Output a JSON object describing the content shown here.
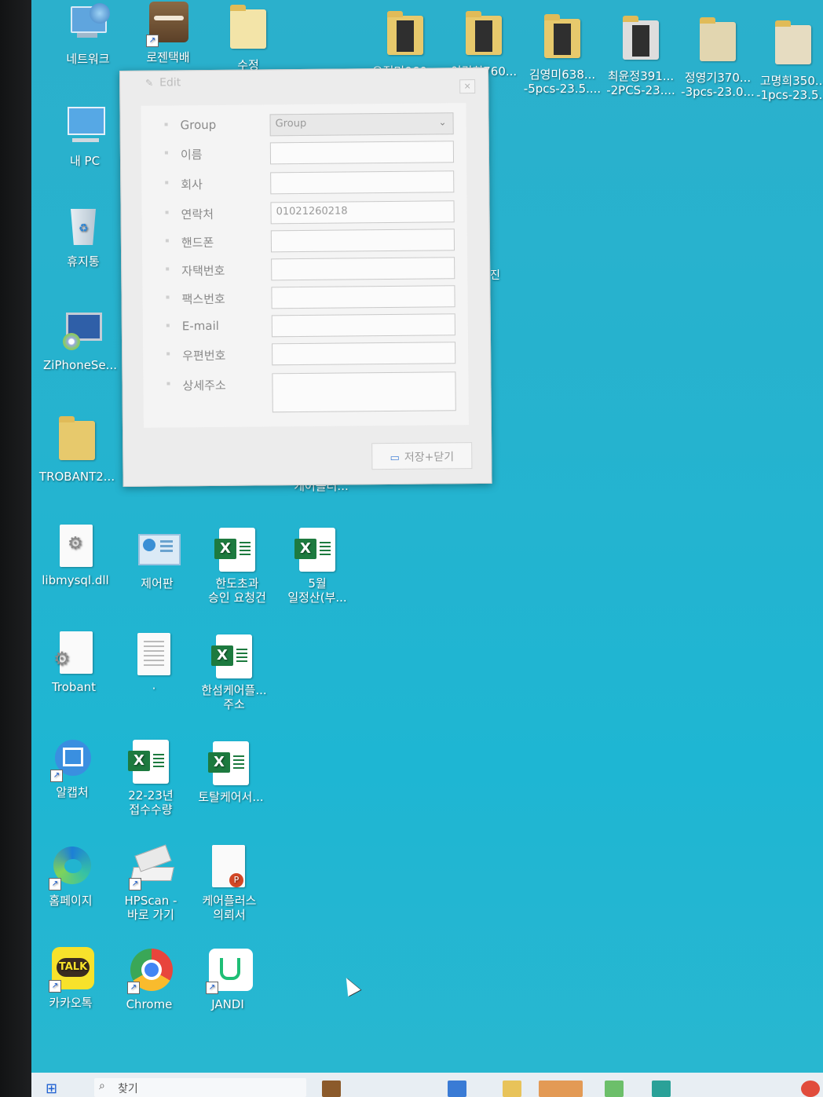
{
  "desktop_icons": [
    {
      "label": "네트워크",
      "icon": "network-icon"
    },
    {
      "label": "로젠택배",
      "icon": "app-shortcut-icon"
    },
    {
      "label": "수정",
      "icon": "folder-icon"
    },
    {
      "label": "오정미060...",
      "icon": "folder-icon"
    },
    {
      "label": "이경희760...",
      "icon": "folder-icon"
    },
    {
      "label": "김영미638...\n-5pcs-23.5....",
      "icon": "folder-icon"
    },
    {
      "label": "최윤정391...\n-2PCS-23....",
      "icon": "folder-icon"
    },
    {
      "label": "정영기370...\n-3pcs-23.0...",
      "icon": "folder-icon"
    },
    {
      "label": "고명희350...\n-1pcs-23.5...",
      "icon": "folder-icon"
    },
    {
      "label": "내 PC",
      "icon": "computer-icon"
    },
    {
      "label": "휴지통",
      "icon": "recycle-bin-icon"
    },
    {
      "label": "ZiPhoneSe...",
      "icon": "installer-icon"
    },
    {
      "label": "TROBANT2...",
      "icon": "folder-icon"
    },
    {
      "label": "libmysql.dll",
      "icon": "settings-file-icon"
    },
    {
      "label": "제어판",
      "icon": "control-panel-icon"
    },
    {
      "label": "한도초과\n승인 요청건",
      "icon": "excel-icon"
    },
    {
      "label": "5월\n일정산(부...",
      "icon": "excel-icon"
    },
    {
      "label": "Trobant",
      "icon": "settings-file-icon"
    },
    {
      "label": "·",
      "icon": "text-file-icon"
    },
    {
      "label": "한섬케어플...\n주소",
      "icon": "excel-icon"
    },
    {
      "label": "알캡처",
      "icon": "alcapture-icon"
    },
    {
      "label": "22-23년\n접수수량",
      "icon": "excel-icon"
    },
    {
      "label": "토탈케어서...",
      "icon": "excel-icon"
    },
    {
      "label": "홈페이지",
      "icon": "edge-icon"
    },
    {
      "label": "HPScan -\n바로 가기",
      "icon": "scanner-icon"
    },
    {
      "label": "케어플러스\n의뢰서",
      "icon": "powerpoint-icon"
    },
    {
      "label": "카카오톡",
      "icon": "kakaotalk-icon"
    },
    {
      "label": "Chrome",
      "icon": "chrome-icon"
    },
    {
      "label": "JANDI",
      "icon": "jandi-icon"
    }
  ],
  "partial_labels": {
    "behind_dialog": "케어플러...",
    "right_edge": "진"
  },
  "dialog": {
    "title": "Edit",
    "close": "×",
    "fields": [
      {
        "label": "Group",
        "value": "Group",
        "type": "select"
      },
      {
        "label": "이름",
        "value": ""
      },
      {
        "label": "회사",
        "value": ""
      },
      {
        "label": "연락처",
        "value": "01021260218"
      },
      {
        "label": "핸드폰",
        "value": ""
      },
      {
        "label": "자택번호",
        "value": ""
      },
      {
        "label": "팩스번호",
        "value": ""
      },
      {
        "label": "E-mail",
        "value": ""
      },
      {
        "label": "우편번호",
        "value": ""
      },
      {
        "label": "상세주소",
        "value": "",
        "type": "textarea"
      }
    ],
    "save_button": "저장+닫기"
  },
  "taskbar": {
    "search_placeholder": "찾기"
  },
  "colors": {
    "desktop": "#22b4d0",
    "dialog_bg": "#ececec",
    "excel_green": "#1d7a3f"
  }
}
